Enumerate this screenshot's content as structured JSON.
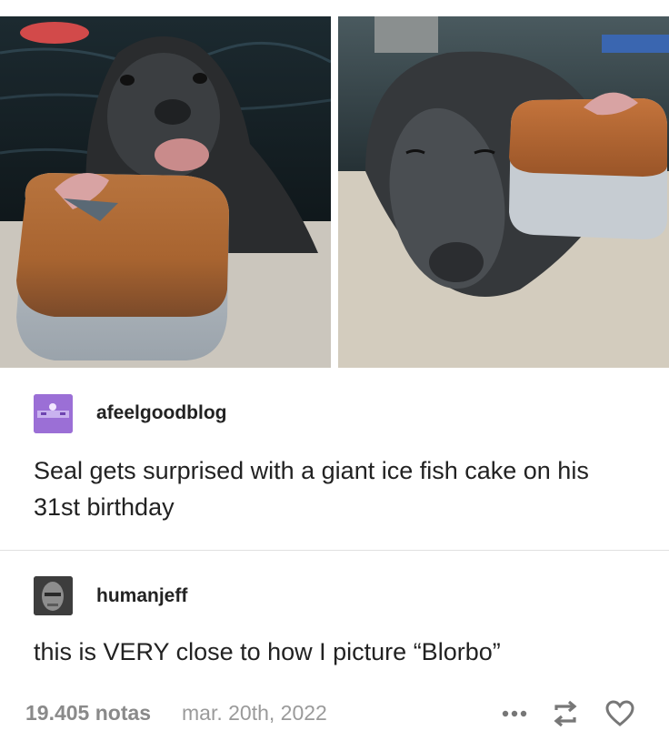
{
  "post": {
    "username": "afeelgoodblog",
    "text": "Seal gets surprised with a giant ice fish cake on his 31st birthday",
    "images": [
      "seal-with-cake-photo",
      "seal-hugging-cake-photo"
    ]
  },
  "reblog": {
    "username": "humanjeff",
    "text": "this is VERY close to how I picture “Blorbo”"
  },
  "footer": {
    "notes": "19.405 notas",
    "date": "mar. 20th, 2022",
    "icons": [
      "more-icon",
      "reblog-icon",
      "heart-icon"
    ]
  },
  "colors": {
    "text": "#222222",
    "meta": "#8a8a8a",
    "avatar_purple": "#9b6fd6"
  }
}
